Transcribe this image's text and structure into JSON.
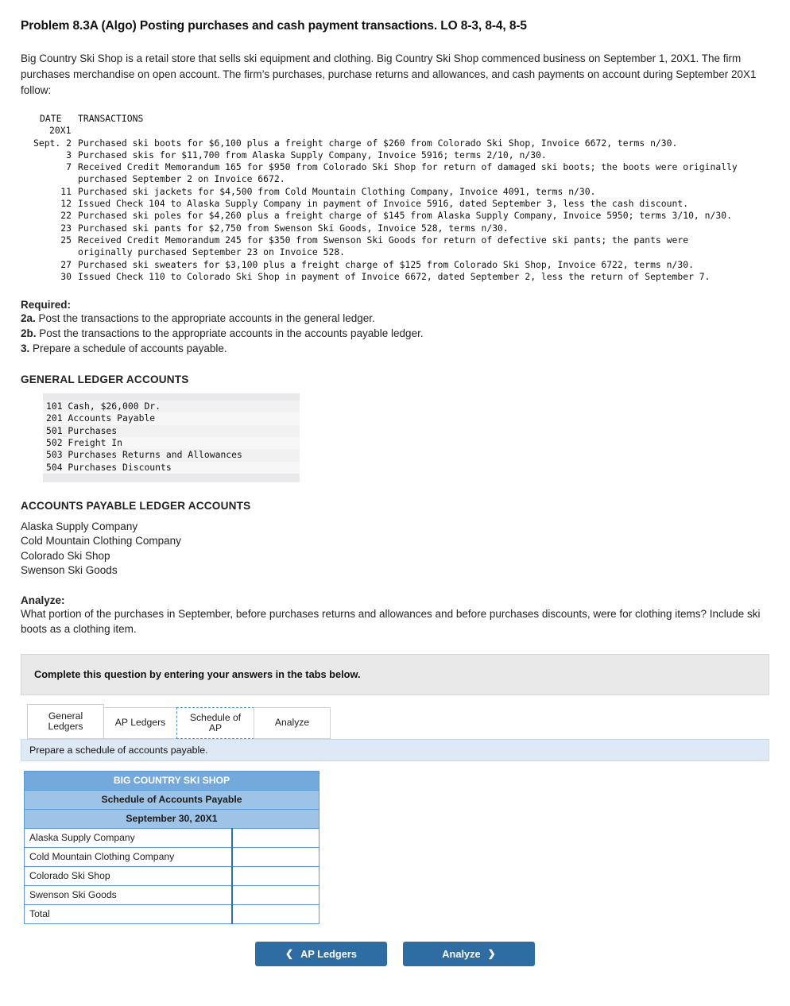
{
  "title": "Problem 8.3A (Algo) Posting purchases and cash payment transactions. LO 8-3, 8-4, 8-5",
  "intro": "Big Country Ski Shop is a retail store that sells ski equipment and clothing. Big Country Ski Shop commenced business on September 1, 20X1. The firm purchases merchandise on open account. The firm’s purchases, purchase returns and allowances, and cash payments on account during September 20X1 follow:",
  "transactions": {
    "col_date": "DATE",
    "col_trans": "TRANSACTIONS",
    "year": "20X1",
    "rows": [
      {
        "date": "Sept. 2",
        "text": "Purchased ski boots for $6,100 plus a freight charge of $260 from Colorado Ski Shop, Invoice 6672, terms n/30."
      },
      {
        "date": "3",
        "text": "Purchased skis for $11,700 from Alaska Supply Company, Invoice 5916; terms 2/10, n/30."
      },
      {
        "date": "7",
        "text": "Received Credit Memorandum 165 for $950 from Colorado Ski Shop for return of damaged ski boots; the boots were originally\npurchased September 2 on Invoice 6672."
      },
      {
        "date": "11",
        "text": "Purchased ski jackets for $4,500 from Cold Mountain Clothing Company, Invoice 4091, terms n/30."
      },
      {
        "date": "12",
        "text": "Issued Check 104 to Alaska Supply Company in payment of Invoice 5916, dated September 3, less the cash discount."
      },
      {
        "date": "22",
        "text": "Purchased ski poles for $4,260 plus a freight charge of $145 from Alaska Supply Company, Invoice 5950; terms 3/10, n/30."
      },
      {
        "date": "23",
        "text": "Purchased ski pants for $2,750 from Swenson Ski Goods, Invoice 528, terms n/30."
      },
      {
        "date": "25",
        "text": "Received Credit Memorandum 245 for $350 from Swenson Ski Goods for return of defective ski pants; the pants were\noriginally purchased September 23 on Invoice 528."
      },
      {
        "date": "27",
        "text": "Purchased ski sweaters for $3,100 plus a freight charge of $125 from Colorado Ski Shop, Invoice 6722, terms n/30."
      },
      {
        "date": "30",
        "text": "Issued Check 110 to Colorado Ski Shop in payment of Invoice 6672, dated September 2, less the return of September 7."
      }
    ]
  },
  "required": {
    "heading": "Required:",
    "items": [
      {
        "num": "2a.",
        "text": " Post the transactions to the appropriate accounts in the general ledger."
      },
      {
        "num": "2b.",
        "text": " Post the transactions to the appropriate accounts in the accounts payable ledger."
      },
      {
        "num": "3.",
        "text": " Prepare a schedule of accounts payable."
      }
    ]
  },
  "general_ledger": {
    "heading": "GENERAL LEDGER ACCOUNTS",
    "accounts": [
      "101 Cash, $26,000 Dr.",
      "201 Accounts Payable",
      "501 Purchases",
      "502 Freight In",
      "503 Purchases Returns and Allowances",
      "504 Purchases Discounts"
    ]
  },
  "ap_ledger": {
    "heading": "ACCOUNTS PAYABLE LEDGER ACCOUNTS",
    "accounts": [
      "Alaska Supply Company",
      "Cold Mountain Clothing Company",
      "Colorado Ski Shop",
      "Swenson Ski Goods"
    ]
  },
  "analyze": {
    "heading": "Analyze:",
    "text": "What portion of the purchases in September, before purchases returns and allowances and before purchases discounts, were for clothing items? Include ski boots as a clothing item."
  },
  "answer_panel": {
    "instruction": "Complete this question by entering your answers in the tabs below.",
    "tabs": [
      {
        "label_line1": "General",
        "label_line2": "Ledgers",
        "selected": false
      },
      {
        "label_line1": "AP Ledgers",
        "label_line2": "",
        "selected": false
      },
      {
        "label_line1": "Schedule of AP",
        "label_line2": "",
        "selected": true
      },
      {
        "label_line1": "Analyze",
        "label_line2": "",
        "selected": false
      }
    ],
    "sub_instruction": "Prepare a schedule of accounts payable."
  },
  "schedule": {
    "company": "BIG COUNTRY SKI SHOP",
    "title": "Schedule of Accounts Payable",
    "date": "September 30, 20X1",
    "rows": [
      {
        "name": "Alaska Supply Company",
        "value": ""
      },
      {
        "name": "Cold Mountain Clothing Company",
        "value": ""
      },
      {
        "name": "Colorado Ski Shop",
        "value": ""
      },
      {
        "name": "Swenson Ski Goods",
        "value": ""
      }
    ],
    "total_label": "Total",
    "total_value": ""
  },
  "footer": {
    "prev_label": "AP Ledgers",
    "prev_icon": "chevron-left-icon",
    "next_label": "Analyze",
    "next_icon": "chevron-right-icon"
  },
  "colors": {
    "accent": "#2e6da4",
    "table_border": "#5b9bd5",
    "header_band": "#74a9dc",
    "subheader_band": "#9dc3e6",
    "subbar": "#ddeaf6"
  }
}
